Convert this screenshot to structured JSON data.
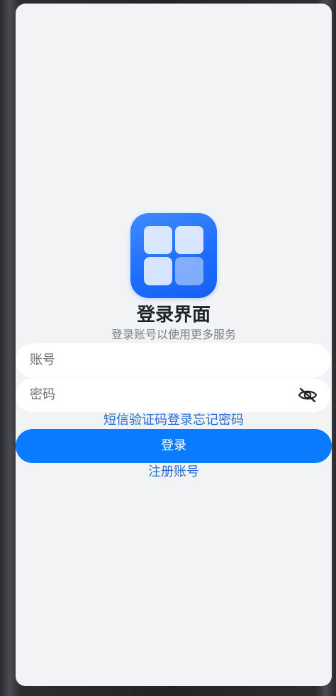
{
  "app": {
    "title": "登录界面",
    "subtitle": "登录账号以使用更多服务"
  },
  "form": {
    "account_placeholder": "账号",
    "password_placeholder": "密码",
    "password_visibility_icon": "eye-off-icon"
  },
  "links": {
    "sms_login": "短信验证码登录",
    "forgot_password": "忘记密码",
    "register": "注册账号"
  },
  "actions": {
    "login_label": "登录"
  },
  "colors": {
    "accent": "#0a7bff",
    "link": "#2a6fd4",
    "background": "#f1f3f5"
  },
  "icons": {
    "logo": "app-grid-logo"
  }
}
